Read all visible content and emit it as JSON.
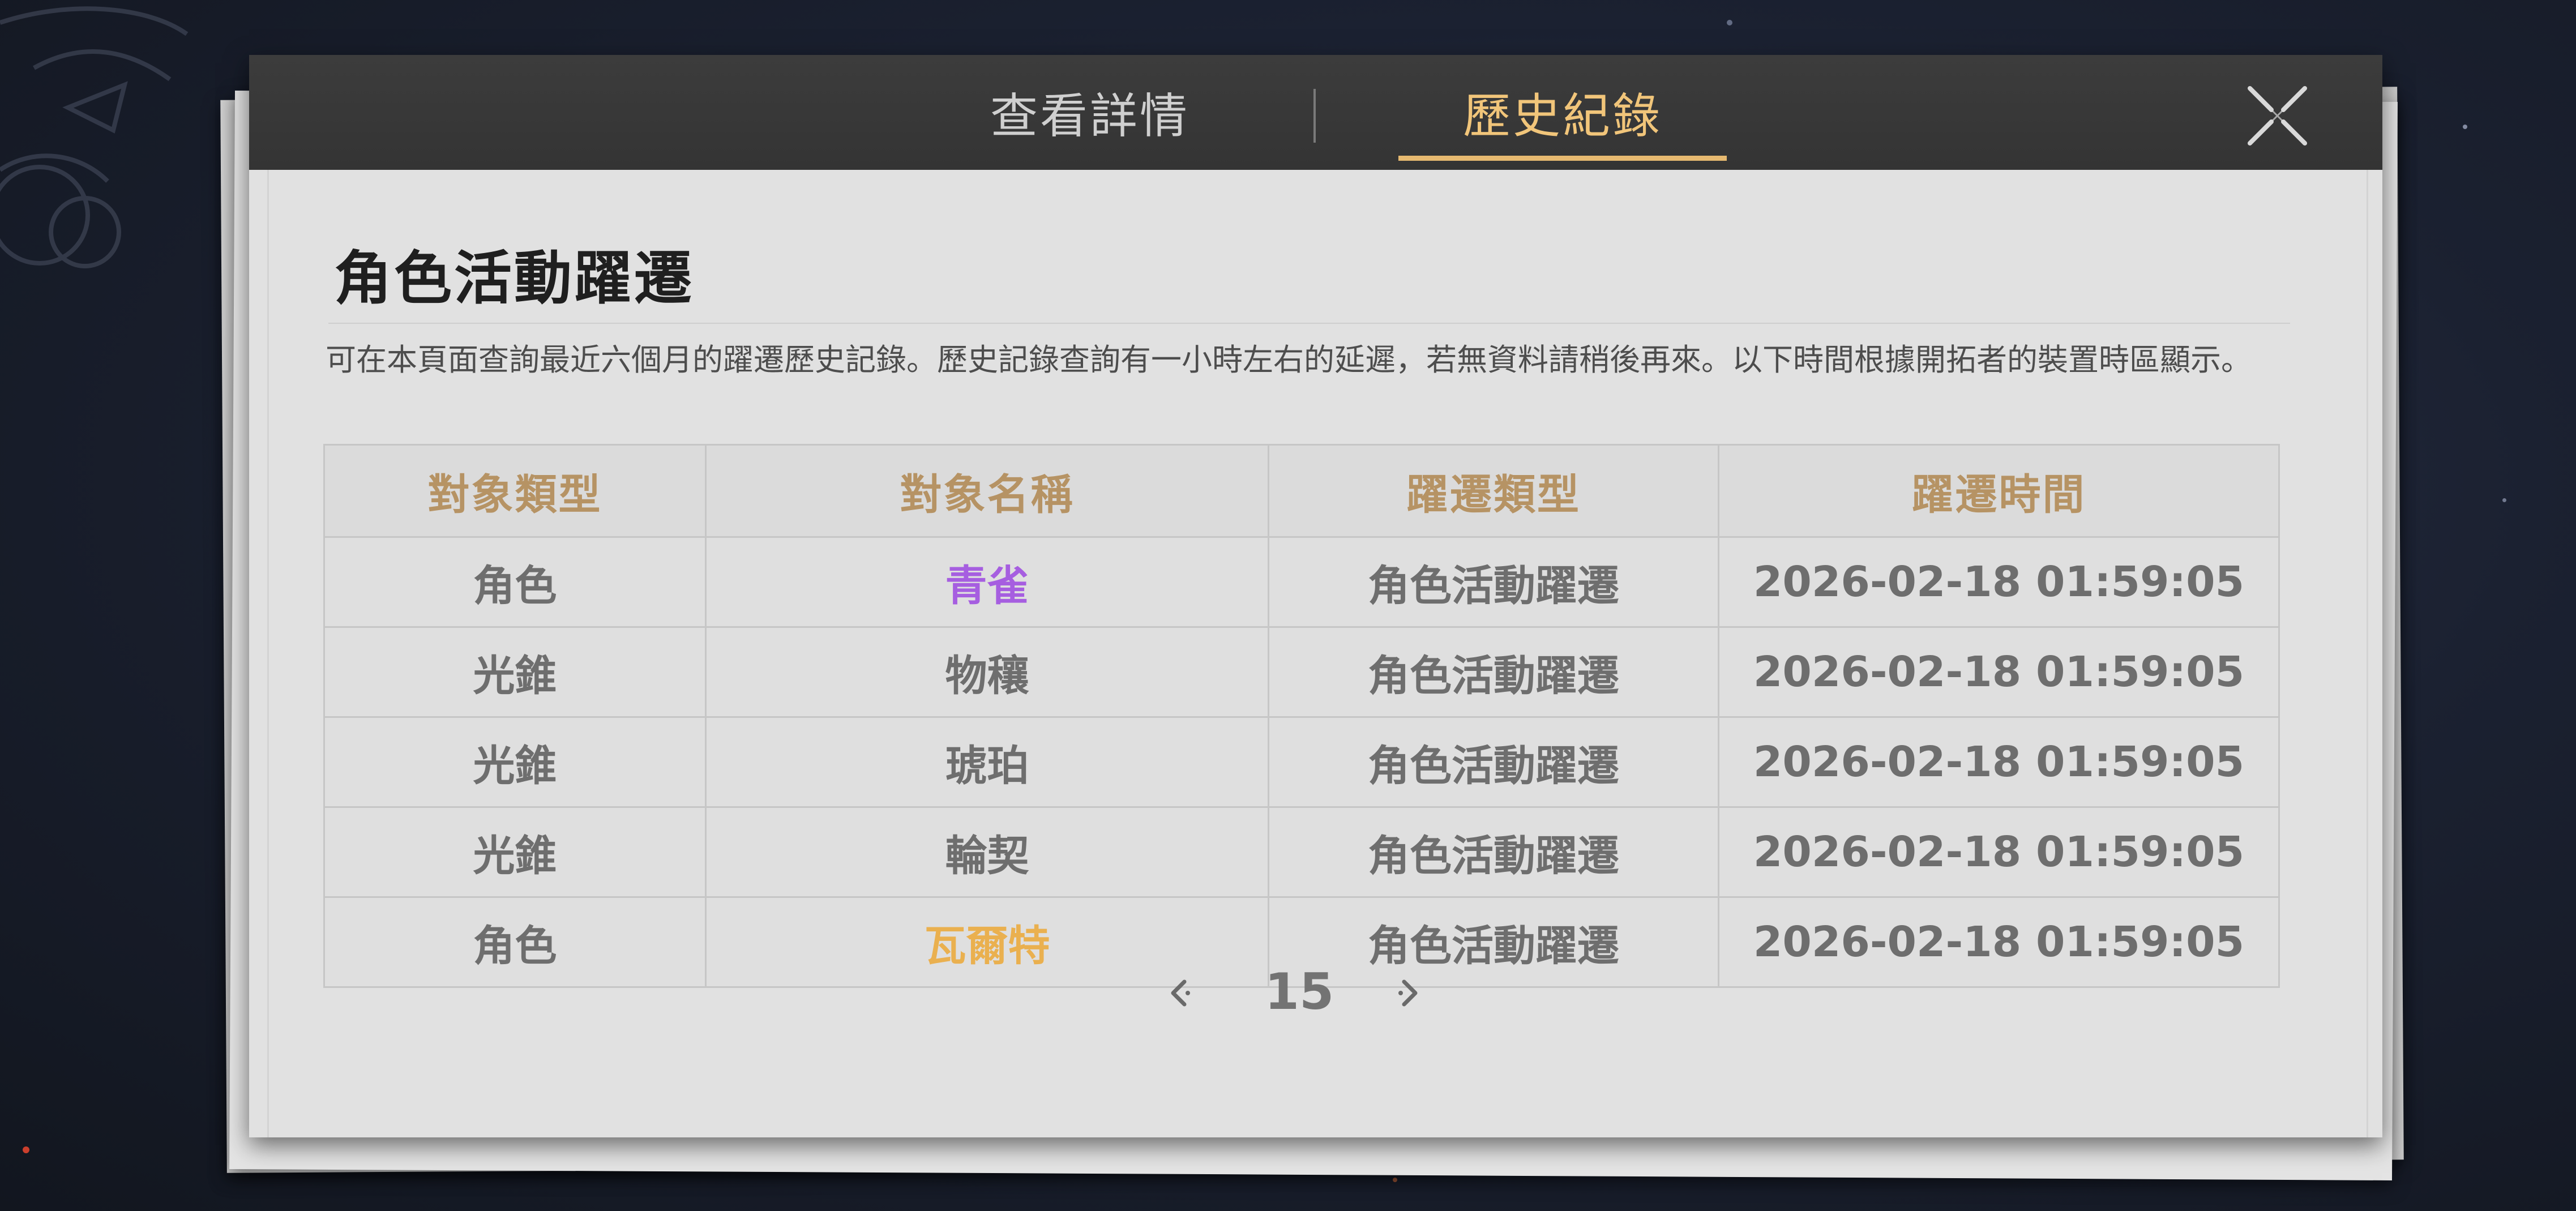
{
  "tabs": [
    {
      "label": "查看詳情",
      "active": false
    },
    {
      "label": "歷史紀錄",
      "active": true
    }
  ],
  "close_icon": "close-icon",
  "page_title": "角色活動躍遷",
  "description": "可在本頁面查詢最近六個月的躍遷歷史記錄。歷史記錄查詢有一小時左右的延遲，若無資料請稍後再來。以下時間根據開拓者的裝置時區顯示。",
  "table": {
    "headers": [
      "對象類型",
      "對象名稱",
      "躍遷類型",
      "躍遷時間"
    ],
    "rows": [
      {
        "type": "角色",
        "name": "青雀",
        "name_color": "#a65ee0",
        "warp_type": "角色活動躍遷",
        "time": "2026-02-18 01:59:05"
      },
      {
        "type": "光錐",
        "name": "物穰",
        "name_color": "#6e6e6e",
        "warp_type": "角色活動躍遷",
        "time": "2026-02-18 01:59:05"
      },
      {
        "type": "光錐",
        "name": "琥珀",
        "name_color": "#6e6e6e",
        "warp_type": "角色活動躍遷",
        "time": "2026-02-18 01:59:05"
      },
      {
        "type": "光錐",
        "name": "輪契",
        "name_color": "#6e6e6e",
        "warp_type": "角色活動躍遷",
        "time": "2026-02-18 01:59:05"
      },
      {
        "type": "角色",
        "name": "瓦爾特",
        "name_color": "#eab04f",
        "warp_type": "角色活動躍遷",
        "time": "2026-02-18 01:59:05"
      }
    ]
  },
  "pagination": {
    "prev_icon": "chevron-left-icon",
    "page": "15",
    "next_icon": "chevron-right-icon"
  },
  "colors": {
    "header_bg": "#3a3a3a",
    "active_tab": "#f1c57a",
    "table_header_text": "#b69364",
    "paper": "#e1e1e1"
  }
}
